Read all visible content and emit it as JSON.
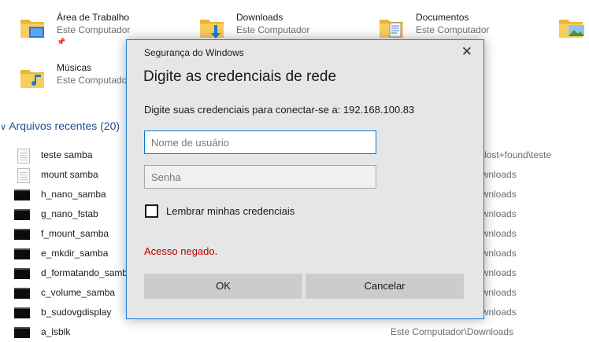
{
  "quick_access": [
    {
      "name": "Área de Trabalho",
      "location": "Este Computador",
      "pinned_icon": "pin-icon",
      "icon": "desktop-folder-icon"
    },
    {
      "name": "Downloads",
      "location": "Este Computador",
      "icon": "downloads-folder-icon"
    },
    {
      "name": "Documentos",
      "location": "Este Computador",
      "icon": "documents-folder-icon"
    },
    {
      "name": "",
      "location": "",
      "icon": "pictures-folder-icon"
    },
    {
      "name": "Músicas",
      "location": "Este Computador",
      "icon": "music-folder-icon"
    }
  ],
  "recent": {
    "header": "Arquivos recentes (20)",
    "items": [
      {
        "name": "teste samba",
        "path": "a\\lost+found\\teste",
        "icon": "text-file-icon"
      },
      {
        "name": "mount samba",
        "path": "ownloads",
        "icon": "text-file-icon"
      },
      {
        "name": "h_nano_samba",
        "path": "ownloads",
        "icon": "terminal-image-icon"
      },
      {
        "name": "g_nano_fstab",
        "path": "ownloads",
        "icon": "terminal-image-icon"
      },
      {
        "name": "f_mount_samba",
        "path": "ownloads",
        "icon": "terminal-image-icon"
      },
      {
        "name": "e_mkdir_samba",
        "path": "ownloads",
        "icon": "terminal-image-icon"
      },
      {
        "name": "d_formatando_samb",
        "path": "ownloads",
        "icon": "terminal-image-icon"
      },
      {
        "name": "c_volume_samba",
        "path": "ownloads",
        "icon": "terminal-image-icon"
      },
      {
        "name": "b_sudovgdisplay",
        "path": "ownloads",
        "icon": "terminal-image-icon"
      },
      {
        "name": "a_lsblk",
        "path": "Este Computador\\Downloads",
        "icon": "terminal-image-icon"
      }
    ]
  },
  "dialog": {
    "window_title": "Segurança do Windows",
    "close_glyph": "✕",
    "heading": "Digite as credenciais de rede",
    "message": "Digite suas credenciais para conectar-se a: 192.168.100.83",
    "username": {
      "value": "",
      "placeholder": "Nome de usuário"
    },
    "password": {
      "value": "",
      "placeholder": "Senha"
    },
    "remember_label": "Lembrar minhas credenciais",
    "remember_checked": false,
    "error": "Acesso negado.",
    "ok_label": "OK",
    "cancel_label": "Cancelar"
  },
  "colors": {
    "accent": "#0078d7",
    "error": "#b50000",
    "folder": "#f3c542"
  }
}
